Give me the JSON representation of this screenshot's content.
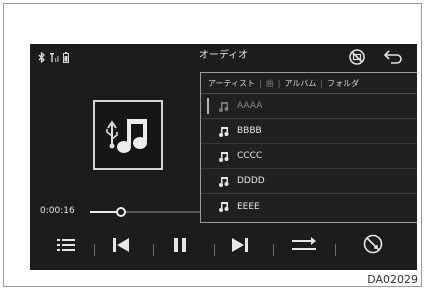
{
  "screen": {
    "title": "オーディオ"
  },
  "playback": {
    "elapsed": "0:00:16",
    "progress_fraction": 0.22
  },
  "browse_panel": {
    "tabs": [
      {
        "label": "アーティスト",
        "active": true
      },
      {
        "label": "曲",
        "active": false
      },
      {
        "label": "アルバム",
        "active": true
      },
      {
        "label": "フォルダ",
        "active": true
      }
    ],
    "items": [
      {
        "label": "AAAA",
        "highlighted": true
      },
      {
        "label": "BBBB"
      },
      {
        "label": "CCCC"
      },
      {
        "label": "DDDD"
      },
      {
        "label": "EEEE"
      }
    ]
  },
  "controls": [
    {
      "name": "list-icon"
    },
    {
      "name": "previous-track-icon"
    },
    {
      "name": "pause-icon"
    },
    {
      "name": "next-track-icon"
    },
    {
      "name": "repeat-icon"
    },
    {
      "name": "shuffle-off-icon"
    }
  ],
  "status_icons": [
    "bluetooth-icon",
    "signal-icon",
    "battery-icon"
  ],
  "figure_code": "DA02029",
  "colors": {
    "screen_bg": "#1c1c1c",
    "text": "#e6e6e6",
    "panel_border": "#9a9a9a"
  }
}
